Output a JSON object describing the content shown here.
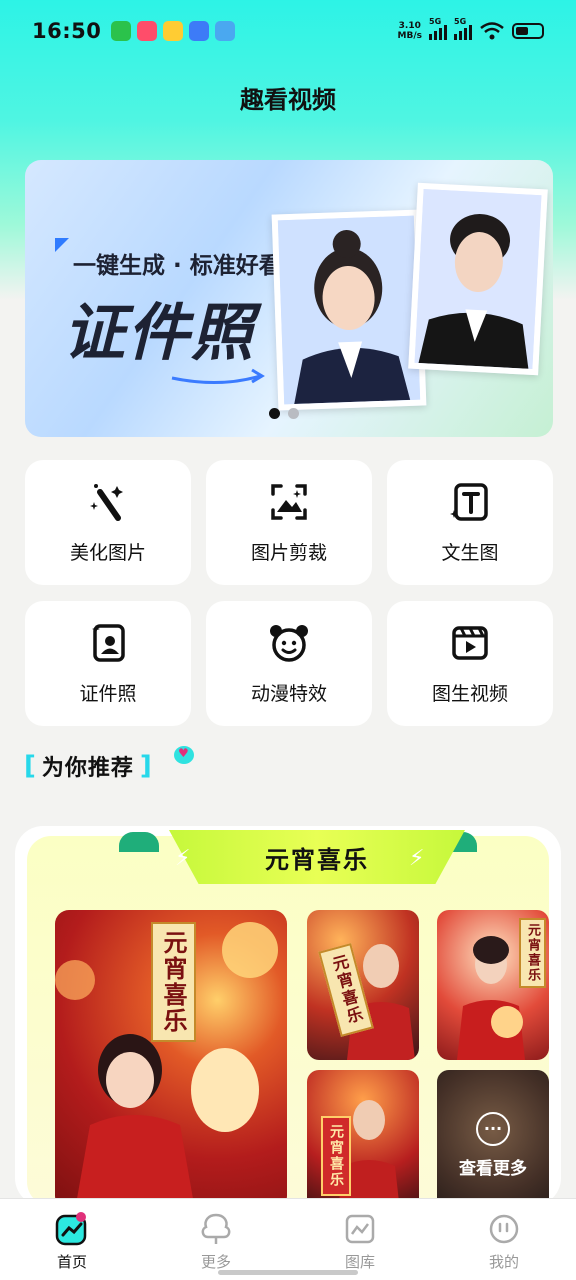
{
  "status_bar": {
    "time": "16:50",
    "net_speed_value": "3.10",
    "net_speed_unit": "MB/s",
    "signal1": "5G",
    "signal2": "5G"
  },
  "app": {
    "title": "趣看视频"
  },
  "banner": {
    "subtitle": "一键生成 · 标准好看",
    "headline": "证件照",
    "active_slide": 1,
    "slide_count": 2
  },
  "tools": [
    {
      "label": "美化图片",
      "icon": "magic-wand-icon"
    },
    {
      "label": "图片剪裁",
      "icon": "image-crop-icon"
    },
    {
      "label": "文生图",
      "icon": "text-to-image-icon"
    },
    {
      "label": "证件照",
      "icon": "id-photo-icon"
    },
    {
      "label": "动漫特效",
      "icon": "anime-face-icon"
    },
    {
      "label": "图生视频",
      "icon": "image-to-video-icon"
    }
  ],
  "recommend": {
    "title": "为你推荐",
    "card_title": "元宵喜乐",
    "poster_text": "元宵喜乐",
    "more_label": "查看更多"
  },
  "tabbar": {
    "items": [
      {
        "label": "首页",
        "icon": "home-icon",
        "active": true
      },
      {
        "label": "更多",
        "icon": "more-icon",
        "active": false
      },
      {
        "label": "图库",
        "icon": "gallery-icon",
        "active": false
      },
      {
        "label": "我的",
        "icon": "profile-icon",
        "active": false
      }
    ]
  },
  "colors": {
    "accent": "#2df3e6",
    "ribbon": "#d4fb42",
    "card_bg": "#fbffc4"
  }
}
